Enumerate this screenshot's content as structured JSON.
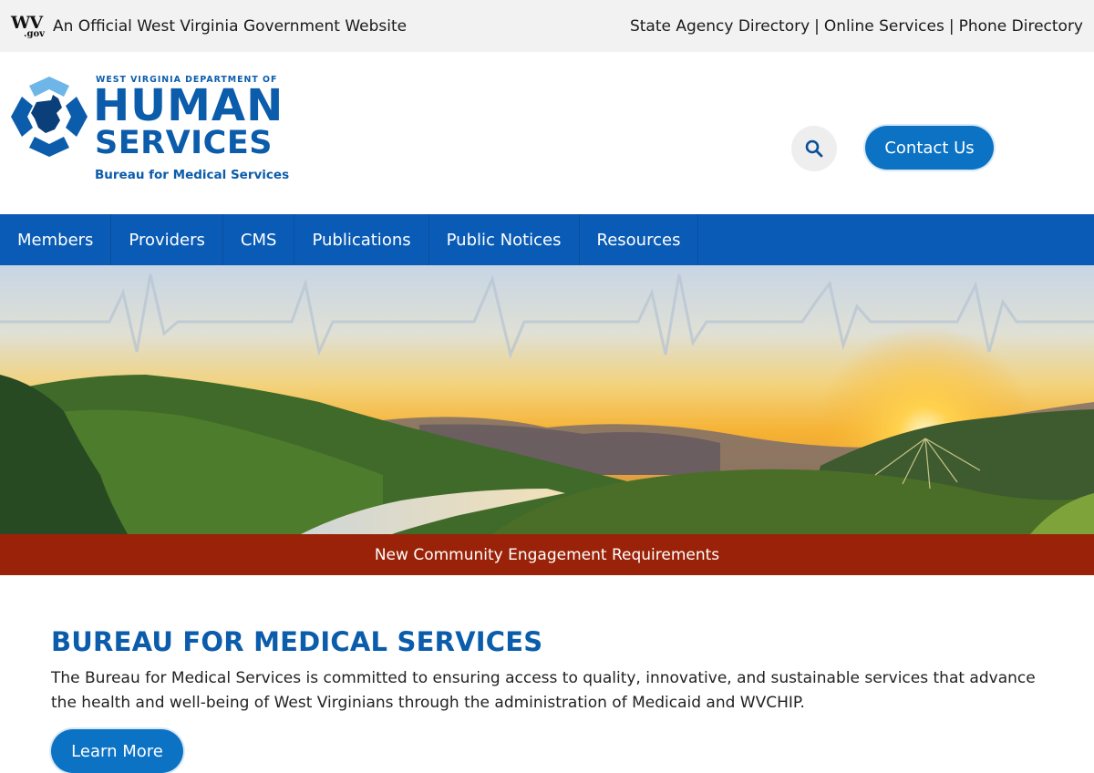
{
  "official_bar": {
    "logo_text": "WV",
    "logo_suffix": ".gov",
    "text": "An Official West Virginia Government Website",
    "links": [
      "State Agency Directory",
      "Online Services",
      "Phone Directory"
    ],
    "separator": "|"
  },
  "brand": {
    "small_line": "WEST VIRGINIA DEPARTMENT OF",
    "line1": "HUMAN",
    "line2": "SERVICES",
    "subtitle": "Bureau for Medical Services"
  },
  "header": {
    "search_icon": "search-icon",
    "contact_label": "Contact Us"
  },
  "nav": {
    "items": [
      "Members",
      "Providers",
      "CMS",
      "Publications",
      "Public Notices",
      "Resources"
    ]
  },
  "announcement": {
    "text": "New Community Engagement Requirements"
  },
  "main": {
    "title": "BUREAU FOR MEDICAL SERVICES",
    "description": "The Bureau for Medical Services is committed to ensuring access to quality, innovative, and sustainable services that advance the health and well-being of West Virginians through the administration of Medicaid and WVCHIP.",
    "learn_more_label": "Learn More"
  },
  "colors": {
    "brand_blue": "#0b5cab",
    "nav_blue": "#0a5bb5",
    "button_blue": "#0b72c4",
    "announcement_red": "#9a2208"
  }
}
